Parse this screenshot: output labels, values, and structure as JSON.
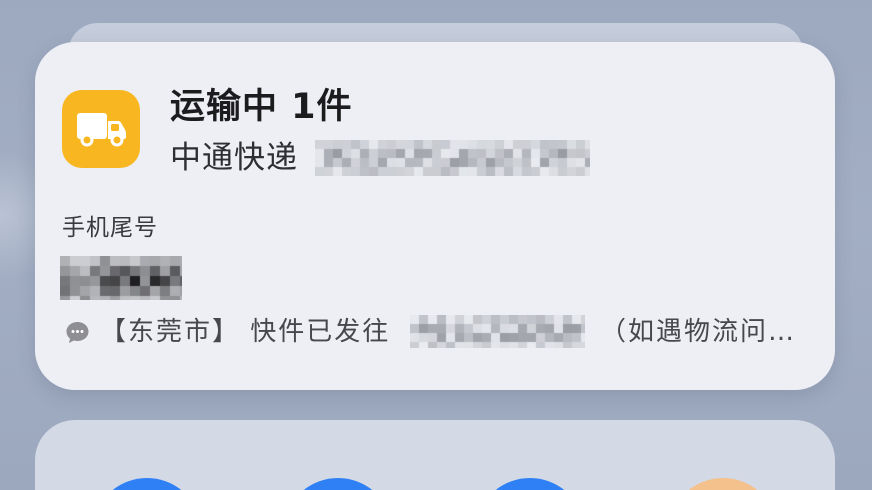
{
  "notification": {
    "app_icon": "truck-icon",
    "app_icon_color": "#f8b620",
    "title": "运输中 1件",
    "courier": "中通快递",
    "phone_label": "手机尾号",
    "message_icon": "chat-bubble-icon",
    "message_prefix": "【东莞市】 快件已发往",
    "message_suffix": "（如遇物流问…"
  },
  "widget": {
    "icon_colors": [
      "#2f7ff5",
      "#2f7ff5",
      "#2f7ff5",
      "#f4c08c"
    ]
  },
  "colors": {
    "card_background": "#edeff4",
    "text_primary": "#1c1c1e",
    "text_secondary": "#47484c",
    "message_icon_color": "#8e8e93",
    "redaction_gray": "#5f636b",
    "redaction_dark": "#101012"
  }
}
